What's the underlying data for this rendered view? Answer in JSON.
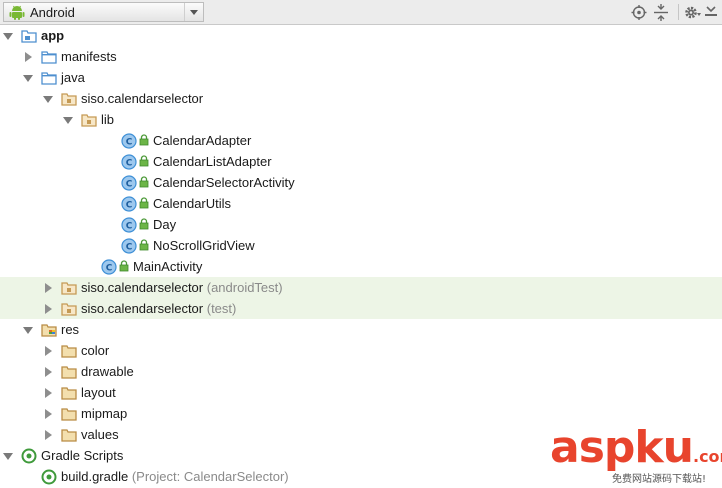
{
  "toolbar": {
    "view_label": "Android",
    "icons": [
      "android-icon",
      "dropdown-arrow-icon",
      "locate-icon",
      "collapse-all-icon",
      "settings-gear-icon",
      "hide-panel-icon"
    ]
  },
  "tree": [
    {
      "label": "app",
      "suffix": "",
      "indent": 0,
      "arrow": "down",
      "icon": "module",
      "bold": true,
      "hl": false
    },
    {
      "label": "manifests",
      "suffix": "",
      "indent": 1,
      "arrow": "right",
      "icon": "folder",
      "hl": false
    },
    {
      "label": "java",
      "suffix": "",
      "indent": 1,
      "arrow": "down",
      "icon": "folder",
      "hl": false
    },
    {
      "label": "siso.calendarselector",
      "suffix": "",
      "indent": 2,
      "arrow": "down",
      "icon": "package",
      "hl": false
    },
    {
      "label": "lib",
      "suffix": "",
      "indent": 3,
      "arrow": "down",
      "icon": "package",
      "hl": false
    },
    {
      "label": "CalendarAdapter",
      "suffix": "",
      "indent": 5,
      "arrow": "none",
      "icon": "class",
      "lock": true,
      "hl": false
    },
    {
      "label": "CalendarListAdapter",
      "suffix": "",
      "indent": 5,
      "arrow": "none",
      "icon": "class",
      "lock": true,
      "hl": false
    },
    {
      "label": "CalendarSelectorActivity",
      "suffix": "",
      "indent": 5,
      "arrow": "none",
      "icon": "class",
      "lock": true,
      "hl": false
    },
    {
      "label": "CalendarUtils",
      "suffix": "",
      "indent": 5,
      "arrow": "none",
      "icon": "class",
      "lock": true,
      "hl": false
    },
    {
      "label": "Day",
      "suffix": "",
      "indent": 5,
      "arrow": "none",
      "icon": "class",
      "lock": true,
      "hl": false
    },
    {
      "label": "NoScrollGridView",
      "suffix": "",
      "indent": 5,
      "arrow": "none",
      "icon": "class",
      "lock": true,
      "hl": false
    },
    {
      "label": "MainActivity",
      "suffix": "",
      "indent": 4,
      "arrow": "none",
      "icon": "class",
      "lock": true,
      "hl": false
    },
    {
      "label": "siso.calendarselector",
      "suffix": "(androidTest)",
      "indent": 2,
      "arrow": "right",
      "icon": "package",
      "hl": true
    },
    {
      "label": "siso.calendarselector",
      "suffix": "(test)",
      "indent": 2,
      "arrow": "right",
      "icon": "package",
      "hl": true
    },
    {
      "label": "res",
      "suffix": "",
      "indent": 1,
      "arrow": "down",
      "icon": "res-folder",
      "hl": false
    },
    {
      "label": "color",
      "suffix": "",
      "indent": 2,
      "arrow": "right",
      "icon": "folder-brown",
      "hl": false
    },
    {
      "label": "drawable",
      "suffix": "",
      "indent": 2,
      "arrow": "right",
      "icon": "folder-brown",
      "hl": false
    },
    {
      "label": "layout",
      "suffix": "",
      "indent": 2,
      "arrow": "right",
      "icon": "folder-brown",
      "hl": false
    },
    {
      "label": "mipmap",
      "suffix": "",
      "indent": 2,
      "arrow": "right",
      "icon": "folder-brown",
      "hl": false
    },
    {
      "label": "values",
      "suffix": "",
      "indent": 2,
      "arrow": "right",
      "icon": "folder-brown",
      "hl": false
    },
    {
      "label": "Gradle Scripts",
      "suffix": "",
      "indent": 0,
      "arrow": "down",
      "icon": "gradle",
      "hl": false
    },
    {
      "label": "build.gradle",
      "suffix": "(Project: CalendarSelector)",
      "indent": 1,
      "arrow": "none",
      "icon": "gradle",
      "hl": false
    }
  ],
  "watermark": {
    "brand_asp": "asp",
    "brand_ku": "ku",
    "brand_com": ".com",
    "tagline": "免费网站源码下载站!"
  },
  "colors": {
    "highlight": "#edf5e6",
    "class_icon": "#3d8fd6",
    "folder_blue": "#5b9bd5",
    "folder_brown": "#c8a165",
    "lock_green": "#4e9a3a",
    "brand": "#e8442d"
  }
}
